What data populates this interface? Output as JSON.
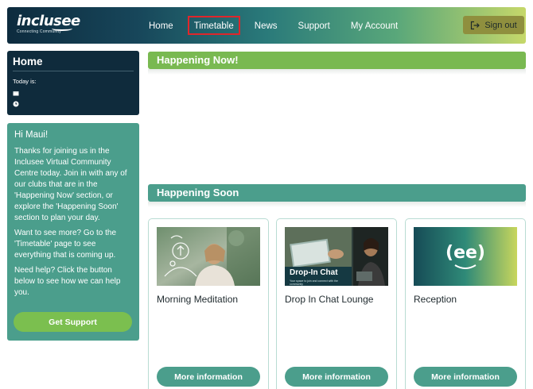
{
  "header": {
    "logo_text": "inclusee",
    "logo_tagline": "Connecting Community",
    "nav": [
      {
        "label": "Home"
      },
      {
        "label": "Timetable"
      },
      {
        "label": "News"
      },
      {
        "label": "Support"
      },
      {
        "label": "My Account"
      }
    ],
    "active_nav": "Timetable",
    "sign_out_label": "Sign out"
  },
  "home_card": {
    "title": "Home",
    "today_label": "Today is:"
  },
  "welcome": {
    "greeting": "Hi Maui!",
    "paragraphs": [
      "Thanks for joining us in the Inclusee Virtual Community Centre today. Join in with any of our clubs that are in the 'Happening Now' section, or explore the 'Happening Soon' section to plan your day.",
      "Want to see more? Go to the 'Timetable' page to see everything that is coming up.",
      "Need help? Click the button below to see how we can help you."
    ],
    "support_button": "Get Support"
  },
  "sections": {
    "now_title": "Happening Now!",
    "soon_title": "Happening Soon"
  },
  "activities": [
    {
      "title": "Morning Meditation",
      "button": "More information",
      "image": "meditation-photo"
    },
    {
      "title": "Drop In Chat Lounge",
      "button": "More information",
      "image": "drop-in-chat-photo",
      "image_caption": "Drop-In Chat",
      "image_subcaption": "Your space to join and connect with the community"
    },
    {
      "title": "Reception",
      "button": "More information",
      "image": "reception-logo",
      "image_caption": "(ee)"
    }
  ],
  "colors": {
    "header_dark": "#0d2b3e",
    "header_light": "#c6d86a",
    "navy_card": "#0f2b3c",
    "teal": "#4b9e8c",
    "green": "#79b951",
    "active_outline": "#e0262b"
  }
}
